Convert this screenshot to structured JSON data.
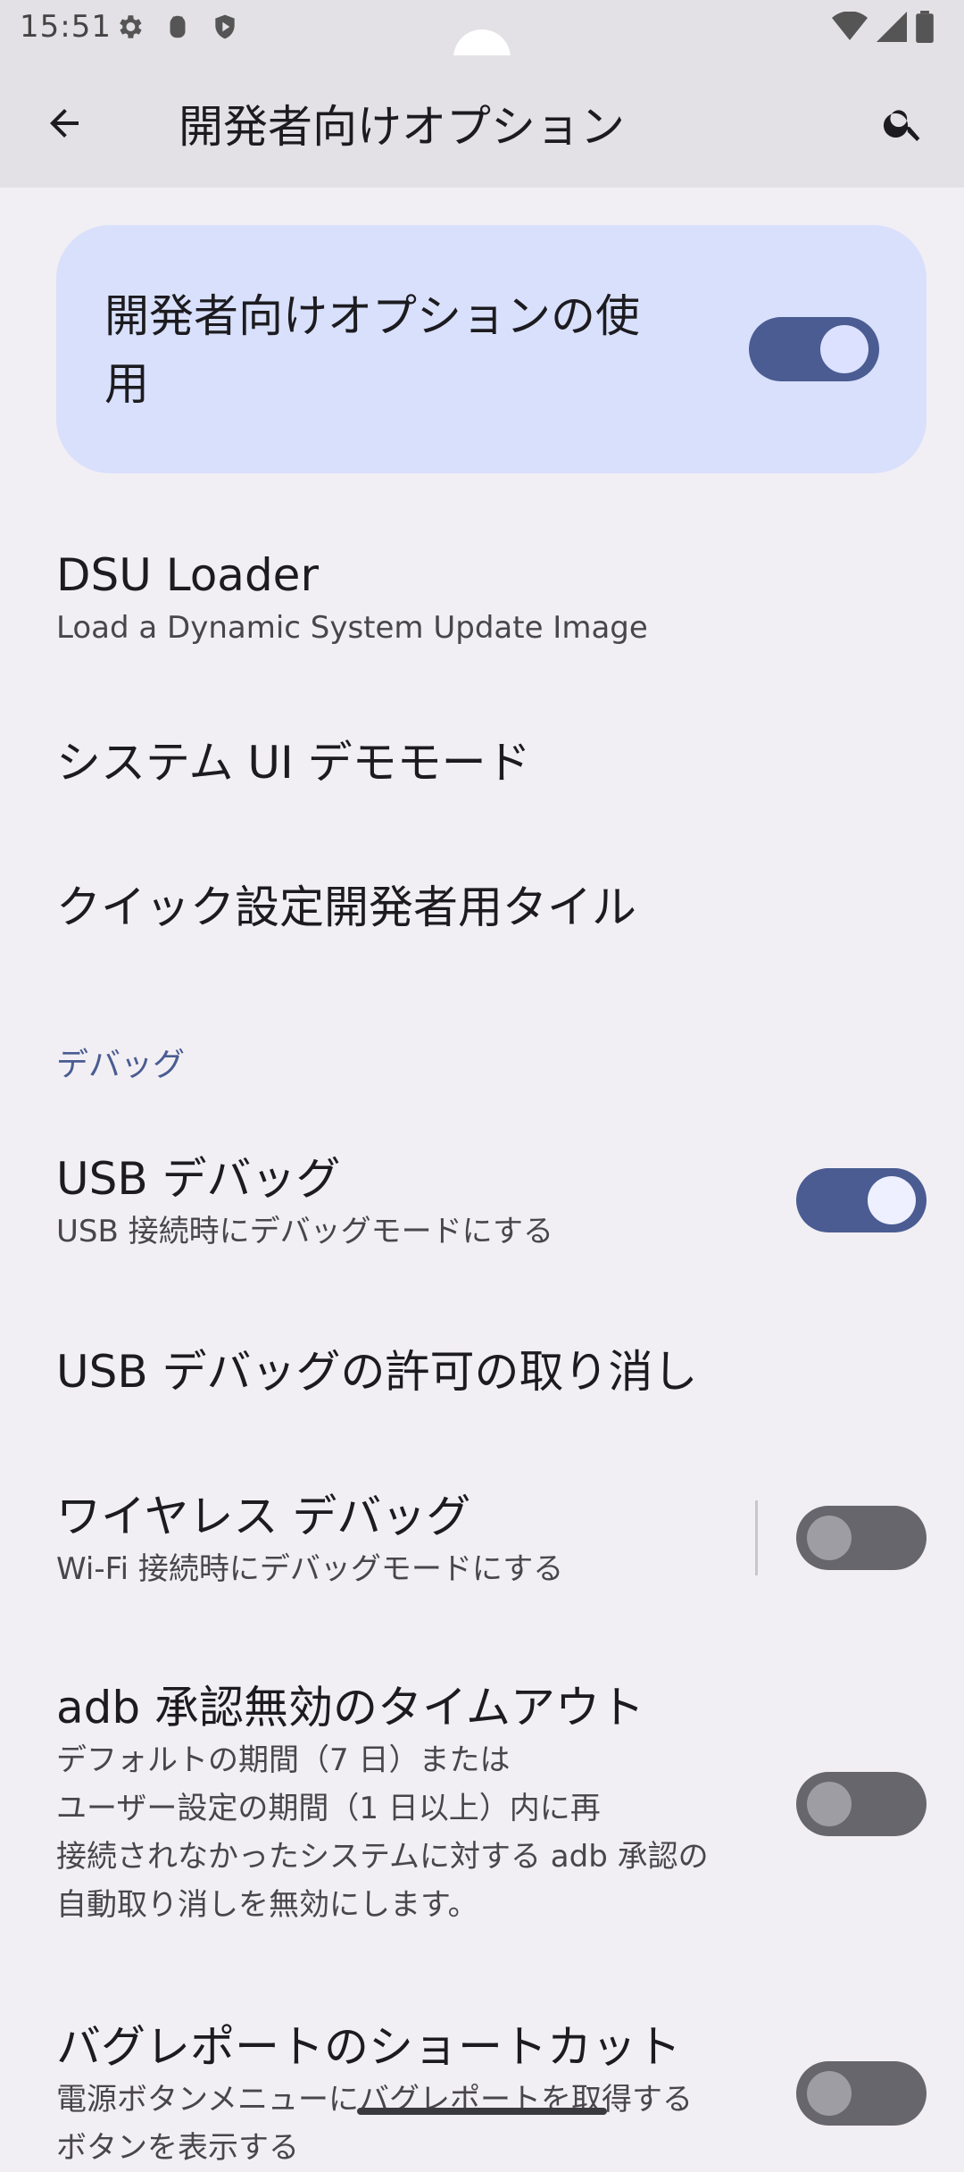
{
  "status_bar": {
    "time": "15:51",
    "left_icons": [
      "gear-icon",
      "android-debug-icon",
      "shield-play-icon"
    ],
    "right_icons": [
      "wifi-icon",
      "cell-signal-icon",
      "battery-icon"
    ]
  },
  "app_bar": {
    "title": "開発者向けオプション",
    "back_icon": "arrow-back-icon",
    "search_icon": "search-icon"
  },
  "main_toggle": {
    "label": "開発者向けオプションの使用",
    "state": "on"
  },
  "items": [
    {
      "title": "DSU Loader",
      "subtitle": "Load a Dynamic System Update Image"
    },
    {
      "title": "システム UI デモモード"
    },
    {
      "title": "クイック設定開発者用タイル"
    }
  ],
  "debug_section": {
    "header": "デバッグ",
    "usb_debug": {
      "title": "USB デバッグ",
      "subtitle": "USB 接続時にデバッグモードにする",
      "state": "on"
    },
    "revoke_usb": {
      "title": "USB デバッグの許可の取り消し"
    },
    "wireless_debug": {
      "title": "ワイヤレス デバッグ",
      "subtitle": "Wi-Fi 接続時にデバッグモードにする",
      "state": "off"
    },
    "adb_timeout": {
      "title": "adb 承認無効のタイムアウト",
      "subtitle_lines": [
        "デフォルトの期間（7 日）または",
        "ユーザー設定の期間（1 日以上）内に再",
        "接続されなかったシステムに対する adb 承認の",
        "自動取り消しを無効にします。"
      ],
      "state": "off"
    },
    "bugreport_shortcut": {
      "title": "バグレポートのショートカット",
      "subtitle_lines": [
        "電源ボタンメニューにバグレポートを取得する",
        "ボタンを表示する"
      ],
      "state": "off"
    }
  },
  "colors": {
    "accent": "#4a5c92",
    "card_bg": "#d9e0fc",
    "page_bg": "#f2eff4",
    "switch_off": "#67666d"
  }
}
